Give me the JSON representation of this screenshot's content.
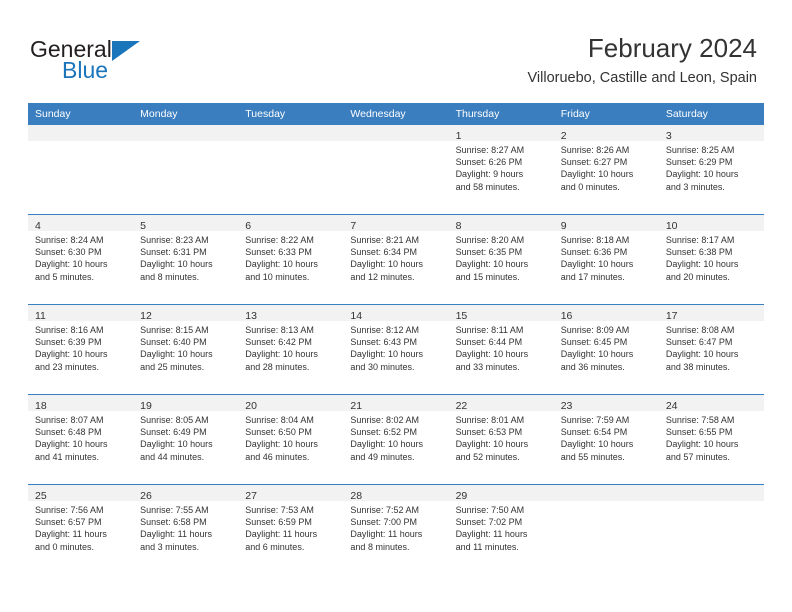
{
  "brand": {
    "line1": "General",
    "line2": "Blue",
    "logo_icon": "triangle-icon",
    "color_text": "#231f20",
    "color_accent": "#1b75bb"
  },
  "header": {
    "title": "February 2024",
    "subtitle": "Villoruebo, Castille and Leon, Spain"
  },
  "theme": {
    "header_row_bg": "#3a7ebf",
    "daynum_band_bg": "#f2f2f2",
    "text": "#333333"
  },
  "calendar": {
    "weekday_headers": [
      "Sunday",
      "Monday",
      "Tuesday",
      "Wednesday",
      "Thursday",
      "Friday",
      "Saturday"
    ],
    "weeks": [
      [
        {
          "day": "",
          "lines": []
        },
        {
          "day": "",
          "lines": []
        },
        {
          "day": "",
          "lines": []
        },
        {
          "day": "",
          "lines": []
        },
        {
          "day": "1",
          "lines": [
            "Sunrise: 8:27 AM",
            "Sunset: 6:26 PM",
            "Daylight: 9 hours",
            "and 58 minutes."
          ]
        },
        {
          "day": "2",
          "lines": [
            "Sunrise: 8:26 AM",
            "Sunset: 6:27 PM",
            "Daylight: 10 hours",
            "and 0 minutes."
          ]
        },
        {
          "day": "3",
          "lines": [
            "Sunrise: 8:25 AM",
            "Sunset: 6:29 PM",
            "Daylight: 10 hours",
            "and 3 minutes."
          ]
        }
      ],
      [
        {
          "day": "4",
          "lines": [
            "Sunrise: 8:24 AM",
            "Sunset: 6:30 PM",
            "Daylight: 10 hours",
            "and 5 minutes."
          ]
        },
        {
          "day": "5",
          "lines": [
            "Sunrise: 8:23 AM",
            "Sunset: 6:31 PM",
            "Daylight: 10 hours",
            "and 8 minutes."
          ]
        },
        {
          "day": "6",
          "lines": [
            "Sunrise: 8:22 AM",
            "Sunset: 6:33 PM",
            "Daylight: 10 hours",
            "and 10 minutes."
          ]
        },
        {
          "day": "7",
          "lines": [
            "Sunrise: 8:21 AM",
            "Sunset: 6:34 PM",
            "Daylight: 10 hours",
            "and 12 minutes."
          ]
        },
        {
          "day": "8",
          "lines": [
            "Sunrise: 8:20 AM",
            "Sunset: 6:35 PM",
            "Daylight: 10 hours",
            "and 15 minutes."
          ]
        },
        {
          "day": "9",
          "lines": [
            "Sunrise: 8:18 AM",
            "Sunset: 6:36 PM",
            "Daylight: 10 hours",
            "and 17 minutes."
          ]
        },
        {
          "day": "10",
          "lines": [
            "Sunrise: 8:17 AM",
            "Sunset: 6:38 PM",
            "Daylight: 10 hours",
            "and 20 minutes."
          ]
        }
      ],
      [
        {
          "day": "11",
          "lines": [
            "Sunrise: 8:16 AM",
            "Sunset: 6:39 PM",
            "Daylight: 10 hours",
            "and 23 minutes."
          ]
        },
        {
          "day": "12",
          "lines": [
            "Sunrise: 8:15 AM",
            "Sunset: 6:40 PM",
            "Daylight: 10 hours",
            "and 25 minutes."
          ]
        },
        {
          "day": "13",
          "lines": [
            "Sunrise: 8:13 AM",
            "Sunset: 6:42 PM",
            "Daylight: 10 hours",
            "and 28 minutes."
          ]
        },
        {
          "day": "14",
          "lines": [
            "Sunrise: 8:12 AM",
            "Sunset: 6:43 PM",
            "Daylight: 10 hours",
            "and 30 minutes."
          ]
        },
        {
          "day": "15",
          "lines": [
            "Sunrise: 8:11 AM",
            "Sunset: 6:44 PM",
            "Daylight: 10 hours",
            "and 33 minutes."
          ]
        },
        {
          "day": "16",
          "lines": [
            "Sunrise: 8:09 AM",
            "Sunset: 6:45 PM",
            "Daylight: 10 hours",
            "and 36 minutes."
          ]
        },
        {
          "day": "17",
          "lines": [
            "Sunrise: 8:08 AM",
            "Sunset: 6:47 PM",
            "Daylight: 10 hours",
            "and 38 minutes."
          ]
        }
      ],
      [
        {
          "day": "18",
          "lines": [
            "Sunrise: 8:07 AM",
            "Sunset: 6:48 PM",
            "Daylight: 10 hours",
            "and 41 minutes."
          ]
        },
        {
          "day": "19",
          "lines": [
            "Sunrise: 8:05 AM",
            "Sunset: 6:49 PM",
            "Daylight: 10 hours",
            "and 44 minutes."
          ]
        },
        {
          "day": "20",
          "lines": [
            "Sunrise: 8:04 AM",
            "Sunset: 6:50 PM",
            "Daylight: 10 hours",
            "and 46 minutes."
          ]
        },
        {
          "day": "21",
          "lines": [
            "Sunrise: 8:02 AM",
            "Sunset: 6:52 PM",
            "Daylight: 10 hours",
            "and 49 minutes."
          ]
        },
        {
          "day": "22",
          "lines": [
            "Sunrise: 8:01 AM",
            "Sunset: 6:53 PM",
            "Daylight: 10 hours",
            "and 52 minutes."
          ]
        },
        {
          "day": "23",
          "lines": [
            "Sunrise: 7:59 AM",
            "Sunset: 6:54 PM",
            "Daylight: 10 hours",
            "and 55 minutes."
          ]
        },
        {
          "day": "24",
          "lines": [
            "Sunrise: 7:58 AM",
            "Sunset: 6:55 PM",
            "Daylight: 10 hours",
            "and 57 minutes."
          ]
        }
      ],
      [
        {
          "day": "25",
          "lines": [
            "Sunrise: 7:56 AM",
            "Sunset: 6:57 PM",
            "Daylight: 11 hours",
            "and 0 minutes."
          ]
        },
        {
          "day": "26",
          "lines": [
            "Sunrise: 7:55 AM",
            "Sunset: 6:58 PM",
            "Daylight: 11 hours",
            "and 3 minutes."
          ]
        },
        {
          "day": "27",
          "lines": [
            "Sunrise: 7:53 AM",
            "Sunset: 6:59 PM",
            "Daylight: 11 hours",
            "and 6 minutes."
          ]
        },
        {
          "day": "28",
          "lines": [
            "Sunrise: 7:52 AM",
            "Sunset: 7:00 PM",
            "Daylight: 11 hours",
            "and 8 minutes."
          ]
        },
        {
          "day": "29",
          "lines": [
            "Sunrise: 7:50 AM",
            "Sunset: 7:02 PM",
            "Daylight: 11 hours",
            "and 11 minutes."
          ]
        },
        {
          "day": "",
          "lines": []
        },
        {
          "day": "",
          "lines": []
        }
      ]
    ]
  }
}
